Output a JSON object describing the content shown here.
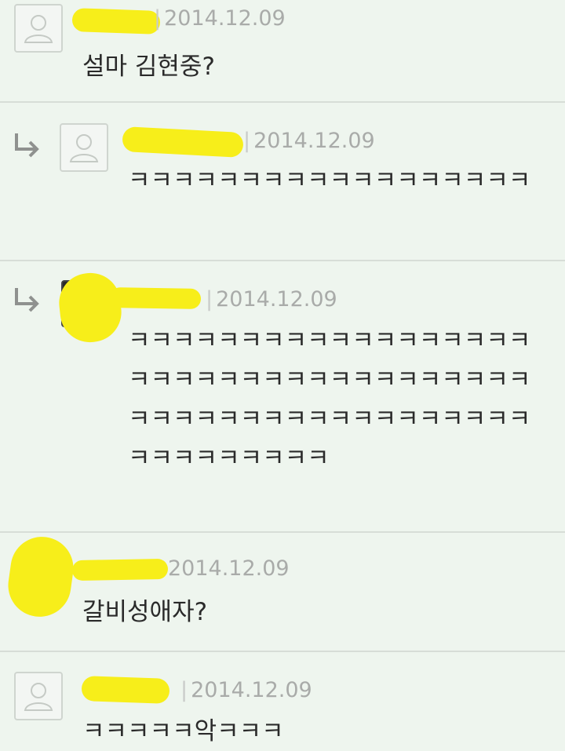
{
  "comments": [
    {
      "date": "2014.12.09",
      "text": "설마 김현중?"
    },
    {
      "date": "2014.12.09",
      "text": "ㅋㅋㅋㅋㅋㅋㅋㅋㅋㅋㅋㅋㅋㅋㅋㅋㅋㅋ"
    },
    {
      "date": "2014.12.09",
      "text": "ㅋㅋㅋㅋㅋㅋㅋㅋㅋㅋㅋㅋㅋㅋㅋㅋㅋㅋㅋㅋㅋㅋㅋㅋㅋㅋㅋㅋㅋㅋㅋㅋㅋㅋㅋㅋㅋㅋㅋㅋㅋㅋㅋㅋㅋㅋㅋㅋㅋㅋㅋㅋㅋㅋㅋㅋㅋㅋㅋㅋㅋㅋㅋ"
    },
    {
      "date": "2014.12.09",
      "text": "갈비성애자?"
    },
    {
      "date": "2014.12.09",
      "text": "ㅋㅋㅋㅋㅋ악ㅋㅋㅋ"
    }
  ],
  "colors": {
    "redaction": "#f7ee1a",
    "background": "#eef5ee"
  },
  "icons": {
    "default_avatar": "user-silhouette-icon",
    "reply": "reply-arrow-icon"
  }
}
